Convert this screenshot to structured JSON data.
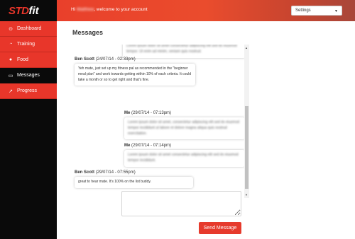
{
  "app": {
    "logo_part1": "STD",
    "logo_part2": "fit"
  },
  "header": {
    "greeting_prefix": "Hi",
    "user_name": "Matthew",
    "greeting_suffix": ", welcome to your account",
    "settings_label": "Settings"
  },
  "sidebar": {
    "items": [
      {
        "label": "Dashboard",
        "icon": "dashboard-icon",
        "glyph": "⊙",
        "active": false
      },
      {
        "label": "Training",
        "icon": "training-icon",
        "glyph": "◔",
        "active": false
      },
      {
        "label": "Food",
        "icon": "apple-icon",
        "glyph": "●",
        "active": false
      },
      {
        "label": "Messages",
        "icon": "messages-icon",
        "glyph": "▭",
        "active": true
      },
      {
        "label": "Progress",
        "icon": "chart-icon",
        "glyph": "↗",
        "active": false
      }
    ]
  },
  "main": {
    "title": "Messages",
    "messages": [
      {
        "author": "",
        "date": "",
        "text": "Lorem ipsum dolor sit amet consectetur adipiscing elit sed do eiusmod tempor. Ut enim ad minim, veniam quis nostrud.",
        "blurred": true
      },
      {
        "author": "Ben Scott",
        "date": "(24/07/14 - 02:33pm)",
        "text": "Yeh mate, just set up my fitness pal as recommended in the \"beginner meal plan\" and work towards getting within 10% of each criteria. It could take a month or so to get right and that's fine.",
        "blurred": false
      },
      {
        "author": "Me",
        "date": "(29/07/14 - 07:13pm)",
        "text": "Lorem ipsum dolor sit amet, consectetur adipiscing elit sed do eiusmod tempor incididunt ut labore et dolore magna aliqua quis nostrud exercitation.",
        "blurred": true
      },
      {
        "author": "Me",
        "date": "(29/07/14 - 07:14pm)",
        "text": "Lorem ipsum dolor sit amet consectetur adipiscing elit sed do eiusmod tempor incididunt.",
        "blurred": true
      },
      {
        "author": "Ben Scott",
        "date": "(29/07/14 - 07:55pm)",
        "text": "great to hear mate. It's 100% on the list buddy.",
        "blurred": false
      }
    ]
  },
  "composer": {
    "send_label": "Send Message"
  },
  "colors": {
    "accent": "#e8362a",
    "sidebar_bg": "#0a0a0a"
  }
}
